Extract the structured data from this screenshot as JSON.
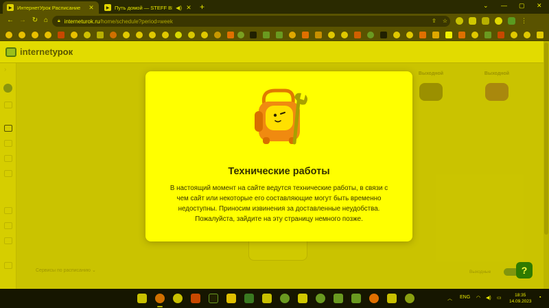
{
  "browser": {
    "tabs": [
      {
        "title": "ИнтернетУрок Расписание",
        "active": true
      },
      {
        "title": "Путь домой — STEFF BLESS",
        "active": false
      }
    ],
    "new_tab": "+",
    "window_controls": [
      "⌄",
      "—",
      "▢",
      "✕"
    ],
    "url_host": "interneturok.ru",
    "url_path": "/home/schedule?period=week"
  },
  "site": {
    "logo_part1": "internet",
    "logo_part2": "урок"
  },
  "background": {
    "columns": [
      {
        "heading": "Выходной",
        "sub": ""
      },
      {
        "heading": "Выходной",
        "sub": ""
      }
    ],
    "select_label": "Сервисы по расписанию",
    "toggle_label": "Выходные"
  },
  "modal": {
    "title": "Технические работы",
    "message": "В настоящий момент на сайте ведутся технические работы, в связи с чем сайт или некоторые его составляющие могут быть временно недоступны. Приносим извинения за доставленные неудобства. Пожалуйста, зайдите на эту страницу немного позже."
  },
  "help_button": "?",
  "taskbar": {
    "language": "ENG",
    "time": "18:35",
    "date": "14.09.2023"
  },
  "colors": {
    "page_background": "#c9c300",
    "modal_background": "#ffff00",
    "help_button": "#2f7a00",
    "backpack": "#f08a10"
  }
}
